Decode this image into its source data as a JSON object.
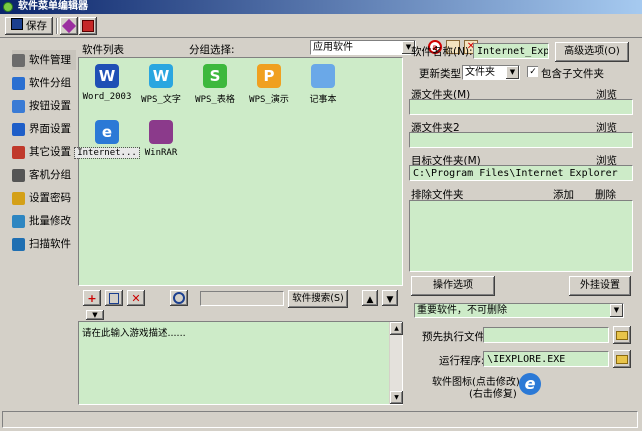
{
  "window": {
    "title": "软件菜单编辑器"
  },
  "toolbar": {
    "save_label": "保存"
  },
  "sidebar": {
    "items": [
      {
        "label": "软件管理",
        "icon": "software-icon",
        "color": "#6b6b6b"
      },
      {
        "label": "软件分组",
        "icon": "group-icon",
        "color": "#2a6fd1"
      },
      {
        "label": "按钮设置",
        "icon": "button-icon",
        "color": "#3a7bd5"
      },
      {
        "label": "界面设置",
        "icon": "interface-icon",
        "color": "#1e5ec8"
      },
      {
        "label": "其它设置",
        "icon": "other-settings-icon",
        "color": "#c0392b"
      },
      {
        "label": "客机分组",
        "icon": "client-group-icon",
        "color": "#555555"
      },
      {
        "label": "设置密码",
        "icon": "lock-icon",
        "color": "#d4a017"
      },
      {
        "label": "批量修改",
        "icon": "batch-edit-icon",
        "color": "#2e86c1"
      },
      {
        "label": "扫描软件",
        "icon": "scan-icon",
        "color": "#1f6fb2"
      }
    ]
  },
  "list": {
    "header": "软件列表",
    "group_label": "分组选择:",
    "group_value": "应用软件",
    "items": [
      {
        "caption": "Word_2003",
        "glyph": "W",
        "bg": "#1f4fb5",
        "icon": "word-icon"
      },
      {
        "caption": "WPS_文字",
        "glyph": "W",
        "bg": "#2aa6e0",
        "icon": "wps-writer-icon"
      },
      {
        "caption": "WPS_表格",
        "glyph": "S",
        "bg": "#3db83d",
        "icon": "wps-sheet-icon"
      },
      {
        "caption": "WPS_演示",
        "glyph": "P",
        "bg": "#f0a020",
        "icon": "wps-presentation-icon"
      },
      {
        "caption": "记事本",
        "glyph": "",
        "bg": "#6aa8e8",
        "icon": "notepad-icon"
      },
      {
        "caption": "Internet...",
        "glyph": "e",
        "bg": "#2b79d6",
        "icon": "internet-explorer-icon"
      },
      {
        "caption": "WinRAR",
        "glyph": "",
        "bg": "#8b3a8b",
        "icon": "winrar-icon"
      }
    ],
    "search_button": "软件搜索(S)",
    "description": "请在此输入游戏描述......"
  },
  "props": {
    "name_label": "软件名称(N):",
    "name_value": "Internet_Explorer",
    "advanced_button": "高级选项(O)",
    "update_type_label": "更新类型:",
    "update_type_value": "文件夹",
    "include_subfolders_label": "包含子文件夹",
    "include_subfolders_checked": true,
    "source_folder_label": "源文件夹(M)",
    "browse1": "浏览",
    "source_folder2_label": "源文件夹2",
    "browse2": "浏览",
    "target_folder_label": "目标文件夹(M)",
    "browse3": "浏览",
    "target_folder_value": "C:\\Program Files\\Internet Explorer",
    "exclude_label": "排除文件夹",
    "add_label": "添加",
    "delete_label": "删除",
    "operation_button": "操作选项",
    "mount_button": "外挂设置",
    "importance_value": "重要软件，不可删除",
    "pre_exec_label": "预先执行文件:",
    "run_label": "运行程序:",
    "run_value": "\\IEXPLORE.EXE",
    "icon_label_1": "软件图标(点击修改)",
    "icon_label_2": "(右击修复)"
  }
}
